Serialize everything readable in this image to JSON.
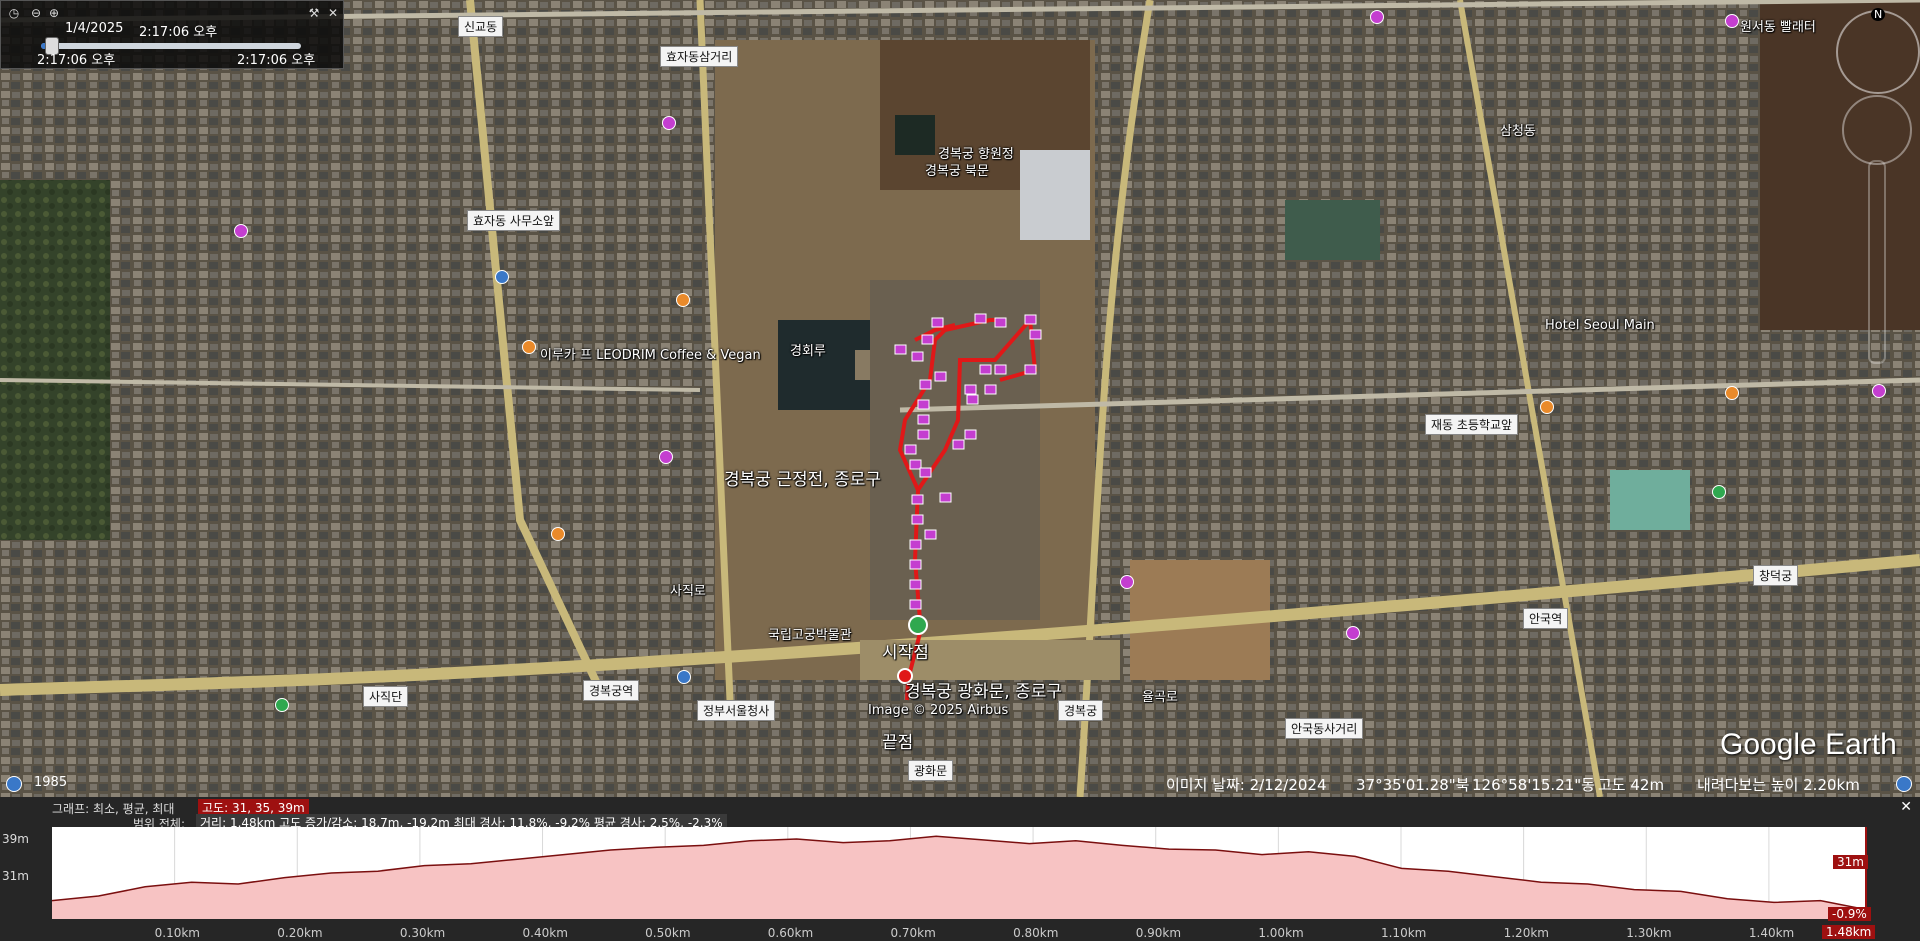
{
  "time_slider": {
    "date_time": "1/4/2025",
    "time_main": "2:17:06 오후",
    "start_time": "2:17:06 오후",
    "end_time": "2:17:06 오후",
    "progress": 0.05,
    "icons": [
      "clock-icon",
      "zoom-out-icon",
      "zoom-in-icon",
      "wrench-icon",
      "close-icon"
    ]
  },
  "map": {
    "labels": [
      {
        "text": "신교동"
      },
      {
        "text": "효자동삼거리"
      },
      {
        "text": "효자동 사무소앞"
      },
      {
        "text": "재동 초등학교앞"
      },
      {
        "text": "사직단"
      },
      {
        "text": "경복궁역"
      },
      {
        "text": "정부서울청사"
      },
      {
        "text": "경복궁"
      },
      {
        "text": "안국동사거리"
      },
      {
        "text": "안국역"
      },
      {
        "text": "창덕궁"
      },
      {
        "text": "광화문"
      },
      {
        "text": "경복궁 근정전, 종로구"
      },
      {
        "text": "경복궁 광화문, 종로구"
      },
      {
        "text": "시작점"
      },
      {
        "text": "끝점"
      },
      {
        "text": "경회루"
      },
      {
        "text": "경복궁 향원정"
      },
      {
        "text": "Image © 2025 Airbus"
      },
      {
        "text": "이루카 프 LEODRIM Coffee & Vegan"
      },
      {
        "text": "원서동 빨래터"
      },
      {
        "text": "Hotel Seoul Main"
      },
      {
        "text": "율곡로"
      },
      {
        "text": "사직로"
      },
      {
        "text": "경복궁 북문"
      },
      {
        "text": "국립고궁박물관"
      },
      {
        "text": "삼청동"
      }
    ],
    "year": "1985",
    "route_color": "#e01818",
    "marker_color": "#c050d0"
  },
  "status_bar": {
    "image_date": "이미지 날짜: 2/12/2024",
    "lat": "37°35'01.28\"북",
    "lon": "126°58'15.21\"동",
    "altitude": "고도   42m",
    "eye_alt": "내려다보는 높이   2.20km"
  },
  "logo": "Google Earth",
  "elevation": {
    "graph_label": "그래프: 최소, 평균, 최대",
    "graph_values": "고도: 31, 35, 39m",
    "range_label": "범위 전체:",
    "range_values": "거리: 1.48km 고도 증가/감소: 18.7m, -19.2m 최대 경사: 11.8%, -9.2% 평균 경사: 2.5%, -2.3%",
    "ymax_label": "39m",
    "ymin_label": "31m",
    "current_value": "31m",
    "current_slope": "-0.9%",
    "current_distance": "1.48km",
    "x_ticks": [
      "0.10km",
      "0.20km",
      "0.30km",
      "0.40km",
      "0.50km",
      "0.60km",
      "0.70km",
      "0.80km",
      "0.90km",
      "1.00km",
      "1.10km",
      "1.20km",
      "1.30km",
      "1.40km"
    ],
    "profile": [
      32,
      32.5,
      33.5,
      34,
      33.8,
      34.5,
      35,
      35.2,
      35.8,
      36,
      36.5,
      37,
      37.5,
      37.8,
      38,
      38.5,
      38.7,
      38.3,
      38.5,
      39,
      38.6,
      38.2,
      38.5,
      38.0,
      37.6,
      37.5,
      37.0,
      37.3,
      36.8,
      35.5,
      35.2,
      34.6,
      34.0,
      33.8,
      33.2,
      33.0,
      32.2,
      31.8,
      32,
      31
    ]
  }
}
